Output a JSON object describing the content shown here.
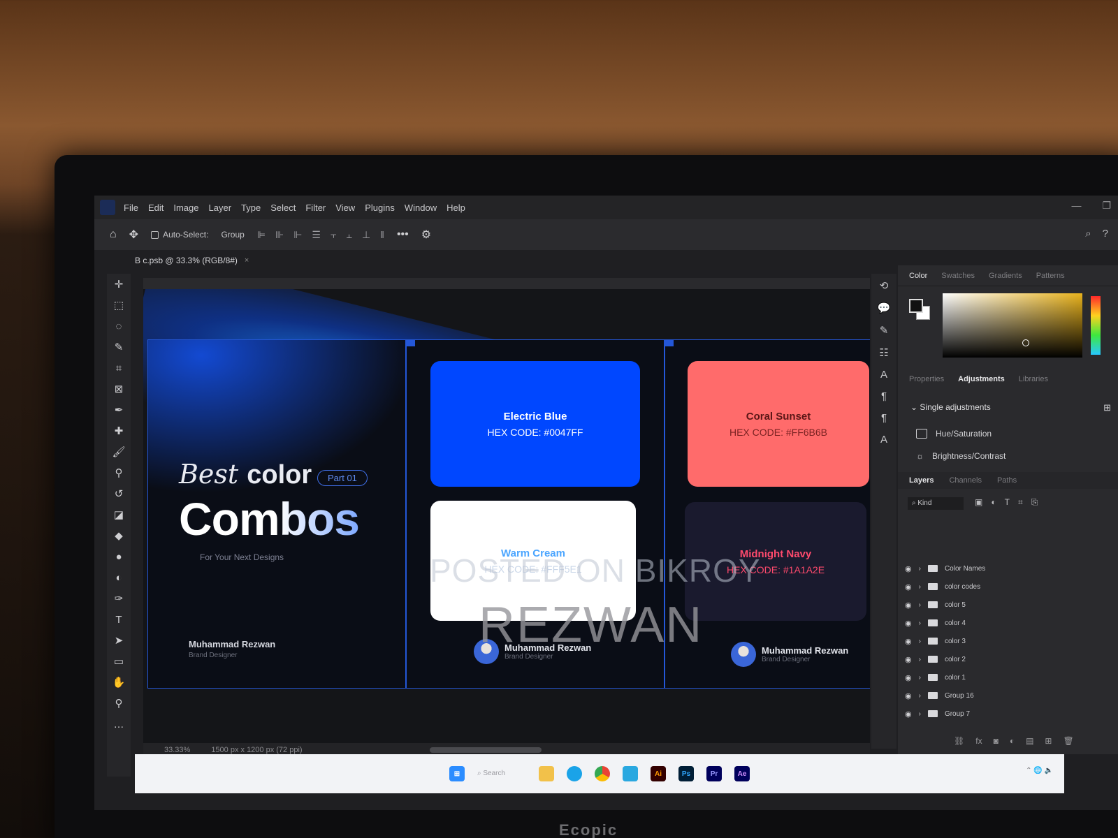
{
  "menubar": {
    "items": [
      "File",
      "Edit",
      "Image",
      "Layer",
      "Type",
      "Select",
      "Filter",
      "View",
      "Plugins",
      "Window",
      "Help"
    ]
  },
  "options": {
    "auto_select": "Auto-Select:",
    "group": "Group"
  },
  "document": {
    "tab_title": "B c.psb @ 33.3% (RGB/8#)"
  },
  "canvas": {
    "title_best": "Best",
    "title_color": "color",
    "part_badge": "Part 01",
    "title_combos": "Combos",
    "subtitle": "For Your Next Designs",
    "author_name": "Muhammad Rezwan",
    "author_role": "Brand Designer",
    "cards": [
      {
        "name": "Electric Blue",
        "hex": "HEX CODE: #0047FF",
        "color": "#0047FF"
      },
      {
        "name": "Warm Cream",
        "hex": "HEX CODE: #FFF5E1",
        "color": "#FFFFFF"
      },
      {
        "name": "Coral Sunset",
        "hex": "HEX CODE: #FF6B6B",
        "color": "#FF6B6B"
      },
      {
        "name": "Midnight Navy",
        "hex": "HEX CODE: #1A1A2E",
        "color": "#1A1A2E"
      }
    ],
    "signature": {
      "name": "Muhammad Rezwan",
      "role": "Brand Designer"
    }
  },
  "watermark": {
    "line1": "POSTED ON BIKROY",
    "line2": "REZWAN"
  },
  "status": {
    "zoom": "33.33%",
    "doc_size": "1500 px x 1200 px (72 ppi)"
  },
  "right_panel": {
    "color_tabs": [
      "Color",
      "Swatches",
      "Gradients",
      "Patterns"
    ],
    "prop_tabs": [
      "Properties",
      "Adjustments",
      "Libraries"
    ],
    "adjustments_header": "Single adjustments",
    "adjustments": [
      "Hue/Saturation",
      "Brightness/Contrast"
    ],
    "layer_tabs": [
      "Layers",
      "Channels",
      "Paths"
    ],
    "layers_filter": "Kind",
    "layers": [
      "Color Names",
      "color codes",
      "color 5",
      "color 4",
      "color 3",
      "color 2",
      "color 1",
      "Group 16",
      "Group 7"
    ]
  },
  "taskbar": {
    "search": "Search",
    "apps": [
      {
        "label": "Ai",
        "color": "#330000"
      },
      {
        "label": "Ps",
        "color": "#001e36"
      },
      {
        "label": "Pr",
        "color": "#00005b"
      },
      {
        "label": "Ae",
        "color": "#00005b"
      }
    ]
  },
  "monitor_brand": "Ecopic"
}
